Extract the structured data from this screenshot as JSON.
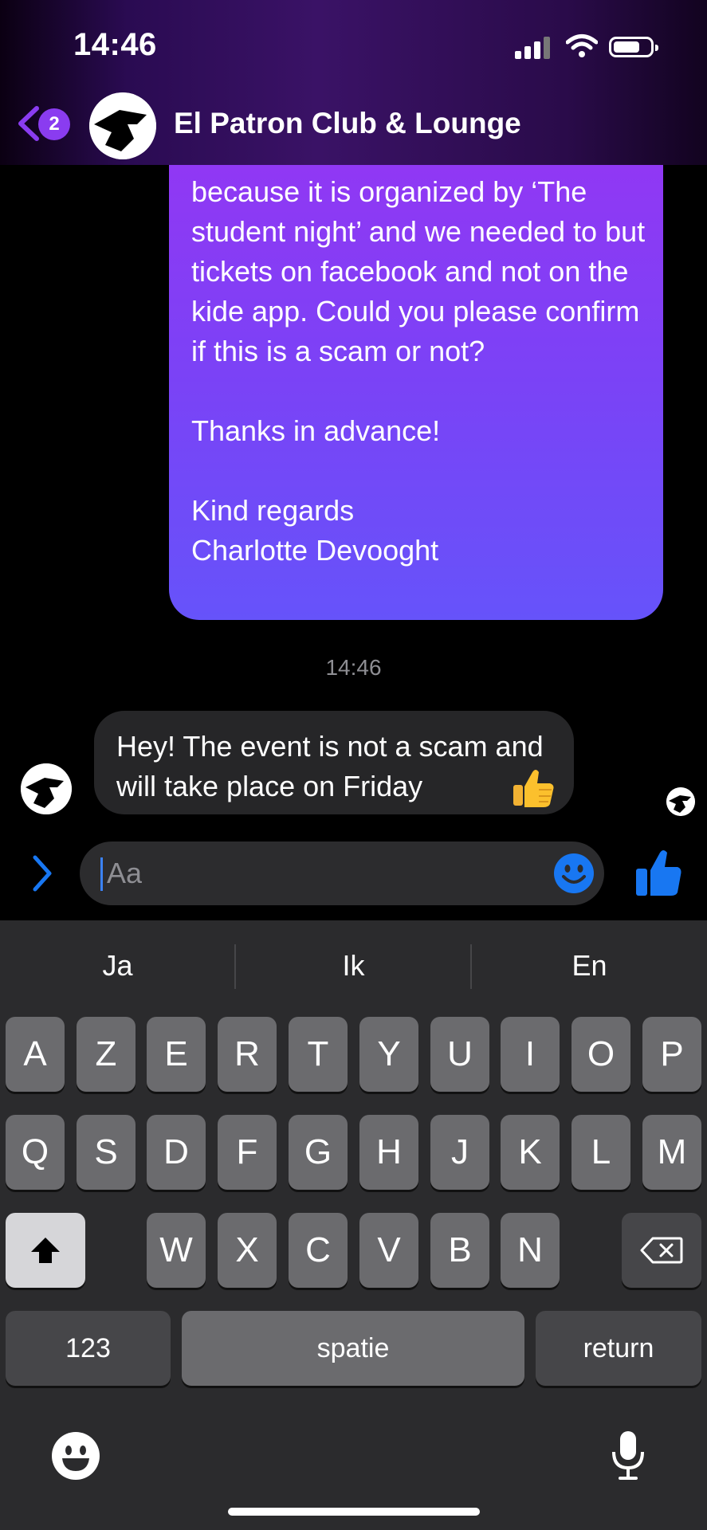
{
  "status_bar": {
    "time": "14:46"
  },
  "header": {
    "unread_count": "2",
    "title": "El Patron Club & Lounge"
  },
  "messages": {
    "outgoing_text": "because it is organized by ‘The student night’ and we needed to but tickets on facebook and not on the kide app. Could you please confirm if this is a scam or not?\n\nThanks in advance!\n\nKind regards\nCharlotte Devooght",
    "timestamp": "14:46",
    "incoming_text": "Hey! The event is not a scam and will take place on Friday"
  },
  "composer": {
    "placeholder": "Aa"
  },
  "keyboard": {
    "suggestions": [
      "Ja",
      "Ik",
      "En"
    ],
    "row1": [
      "A",
      "Z",
      "E",
      "R",
      "T",
      "Y",
      "U",
      "I",
      "O",
      "P"
    ],
    "row2": [
      "Q",
      "S",
      "D",
      "F",
      "G",
      "H",
      "J",
      "K",
      "L",
      "M"
    ],
    "row3": [
      "W",
      "X",
      "C",
      "V",
      "B",
      "N"
    ],
    "numbers_label": "123",
    "space_label": "spatie",
    "return_label": "return"
  },
  "colors": {
    "accent": "#8a3cf0",
    "bubble_out_top": "#9436f3",
    "bubble_out_bottom": "#6653fa",
    "link_blue": "#1877f2"
  },
  "icons": [
    "back-chevron-icon",
    "signal-icon",
    "wifi-icon",
    "battery-icon",
    "expand-chevron-icon",
    "emoji-icon",
    "thumbs-up-icon",
    "shift-icon",
    "delete-icon",
    "microphone-icon"
  ]
}
